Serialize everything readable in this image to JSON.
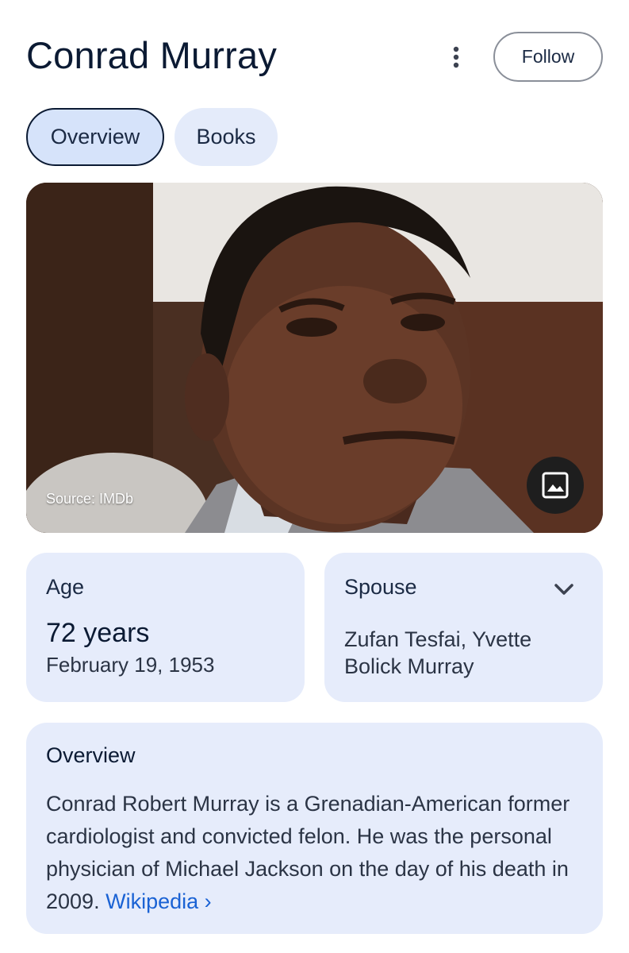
{
  "header": {
    "title": "Conrad Murray",
    "more_icon": "more-vert-icon",
    "follow_label": "Follow"
  },
  "tabs": [
    {
      "label": "Overview",
      "active": true
    },
    {
      "label": "Books",
      "active": false
    }
  ],
  "hero": {
    "source": "Source: IMDb",
    "image_icon": "image-icon"
  },
  "age_card": {
    "label": "Age",
    "value": "72 years",
    "date": "February 19, 1953"
  },
  "spouse_card": {
    "label": "Spouse",
    "value": "Zufan Tesfai, Yvette Bolick Murray",
    "expand_icon": "chevron-down-icon"
  },
  "overview_card": {
    "label": "Overview",
    "text": "Conrad Robert Murray is a Grenadian-American former cardiologist and convicted felon. He was the personal physician of Michael Jackson on the day of his death in 2009.",
    "link_label": "Wikipedia",
    "link_chevron": "›"
  },
  "colors": {
    "accent_link": "#1a62d4",
    "card_bg": "#e6ecfb",
    "active_tab_bg": "#d6e3fa",
    "title_color": "#0b1a33"
  }
}
